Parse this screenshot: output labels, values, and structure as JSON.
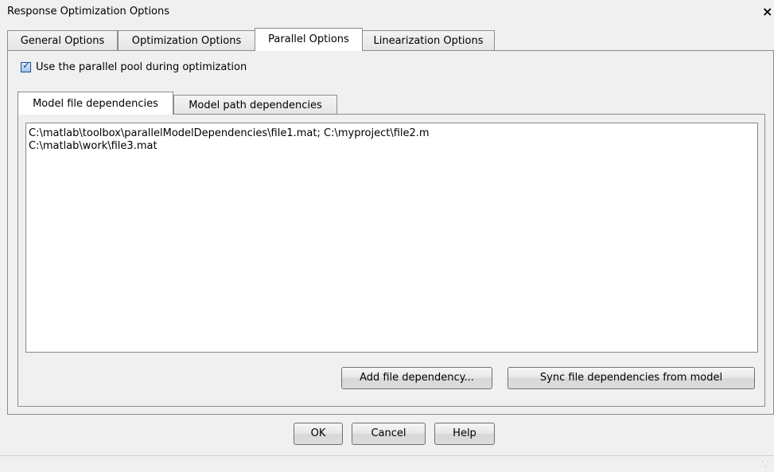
{
  "window": {
    "title": "Response Optimization Options",
    "close_glyph": "×"
  },
  "tabs": [
    {
      "label": "General Options",
      "active": false
    },
    {
      "label": "Optimization Options",
      "active": false
    },
    {
      "label": "Parallel Options",
      "active": true
    },
    {
      "label": "Linearization Options",
      "active": false
    }
  ],
  "parallel": {
    "use_pool_checked": true,
    "use_pool_label": "Use the parallel pool during optimization",
    "check_glyph": "✓",
    "subtabs": [
      {
        "label": "Model file dependencies",
        "active": true
      },
      {
        "label": "Model path dependencies",
        "active": false
      }
    ],
    "dependencies_text": "C:\\matlab\\toolbox\\parallelModelDependencies\\file1.mat; C:\\myproject\\file2.m\nC:\\matlab\\work\\file3.mat",
    "add_button": "Add file dependency...",
    "sync_button": "Sync file dependencies from model"
  },
  "footer": {
    "ok": "OK",
    "cancel": "Cancel",
    "help": "Help"
  },
  "colors": {
    "background": "#f0f0f0",
    "border": "#898c95",
    "checkbox_accent": "#1c4f8f"
  },
  "icons": {
    "close": "close-icon",
    "checkbox": "checkmark-icon",
    "resize": "resize-grip-icon"
  }
}
